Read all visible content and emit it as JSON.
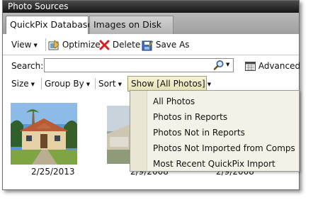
{
  "window": {
    "title": "Photo Sources"
  },
  "tabs": [
    {
      "label": "QuickPix Database",
      "active": true
    },
    {
      "label": "Images on Disk",
      "active": false
    }
  ],
  "toolbar": {
    "view_label": "View",
    "optimize_label": "Optimize",
    "delete_label": "Delete",
    "saveas_label": "Save As"
  },
  "search": {
    "label": "Search:",
    "value": "",
    "placeholder": "",
    "advanced_label": "Advanced"
  },
  "filters": {
    "size_label": "Size",
    "groupby_label": "Group By",
    "sort_label": "Sort",
    "show_label": "Show [All Photos]"
  },
  "show_menu": {
    "items": [
      "All Photos",
      "Photos in Reports",
      "Photos Not in Reports",
      "Photos Not Imported from Comps",
      "Most Recent QuickPix Import"
    ]
  },
  "photos": [
    {
      "date": "2/25/2013"
    },
    {
      "date": "2/9/2008"
    },
    {
      "date": "2/9/2008"
    }
  ],
  "colors": {
    "titlebar": "#2a2a2a",
    "dropdown_bg": "#f4f2e6",
    "show_button_bg": "#ece7bf",
    "delete_icon": "#d42020"
  }
}
